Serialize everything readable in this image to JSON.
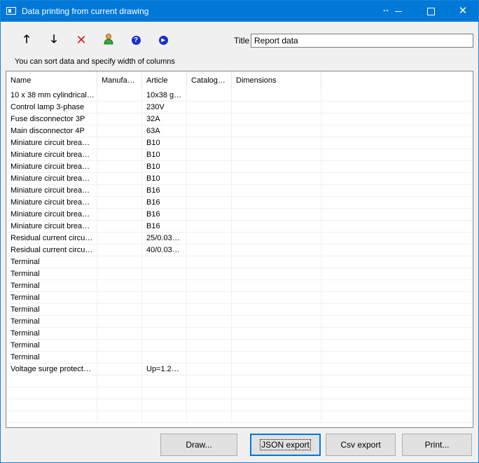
{
  "window": {
    "title": "Data printing from current drawing"
  },
  "toolbar": {
    "icons": [
      "arrow-up-icon",
      "arrow-down-icon",
      "delete-icon",
      "user-icon",
      "help-icon",
      "play-icon"
    ]
  },
  "title_field": {
    "label": "Title",
    "value": "Report data"
  },
  "hint": "You can sort data and specify width of columns",
  "table": {
    "columns": [
      "Name",
      "Manufa…",
      "Article",
      "Catalog…",
      "Dimensions"
    ],
    "rows": [
      [
        "10 x 38 mm cylindrical…",
        "",
        "10x38 g…",
        "",
        ""
      ],
      [
        "Control lamp 3-phase",
        "",
        "230V",
        "",
        ""
      ],
      [
        "Fuse disconnector 3P",
        "",
        "32A",
        "",
        ""
      ],
      [
        "Main disconnector 4P",
        "",
        "63A",
        "",
        ""
      ],
      [
        "Miniature circuit brea…",
        "",
        "B10",
        "",
        ""
      ],
      [
        "Miniature circuit brea…",
        "",
        "B10",
        "",
        ""
      ],
      [
        "Miniature circuit brea…",
        "",
        "B10",
        "",
        ""
      ],
      [
        "Miniature circuit brea…",
        "",
        "B10",
        "",
        ""
      ],
      [
        "Miniature circuit brea…",
        "",
        "B16",
        "",
        ""
      ],
      [
        "Miniature circuit brea…",
        "",
        "B16",
        "",
        ""
      ],
      [
        "Miniature circuit brea…",
        "",
        "B16",
        "",
        ""
      ],
      [
        "Miniature circuit brea…",
        "",
        "B16",
        "",
        ""
      ],
      [
        "Residual current circu…",
        "",
        "25/0.03…",
        "",
        ""
      ],
      [
        "Residual current circu…",
        "",
        "40/0.03…",
        "",
        ""
      ],
      [
        "Terminal",
        "",
        "",
        "",
        ""
      ],
      [
        "Terminal",
        "",
        "",
        "",
        ""
      ],
      [
        "Terminal",
        "",
        "",
        "",
        ""
      ],
      [
        "Terminal",
        "",
        "",
        "",
        ""
      ],
      [
        "Terminal",
        "",
        "",
        "",
        ""
      ],
      [
        "Terminal",
        "",
        "",
        "",
        ""
      ],
      [
        "Terminal",
        "",
        "",
        "",
        ""
      ],
      [
        "Terminal",
        "",
        "",
        "",
        ""
      ],
      [
        "Terminal",
        "",
        "",
        "",
        ""
      ],
      [
        "Voltage surge protect…",
        "",
        "Up=1.2…",
        "",
        ""
      ],
      [
        "",
        "",
        "",
        "",
        ""
      ],
      [
        "",
        "",
        "",
        "",
        ""
      ],
      [
        "",
        "",
        "",
        "",
        ""
      ],
      [
        "",
        "",
        "",
        "",
        ""
      ]
    ]
  },
  "buttons": {
    "draw": "Draw...",
    "json_export": "JSON export",
    "csv_export": "Csv export",
    "print": "Print..."
  },
  "colors": {
    "titlebar": "#0078d7",
    "focus": "#0078d7",
    "delete": "#d82020"
  }
}
